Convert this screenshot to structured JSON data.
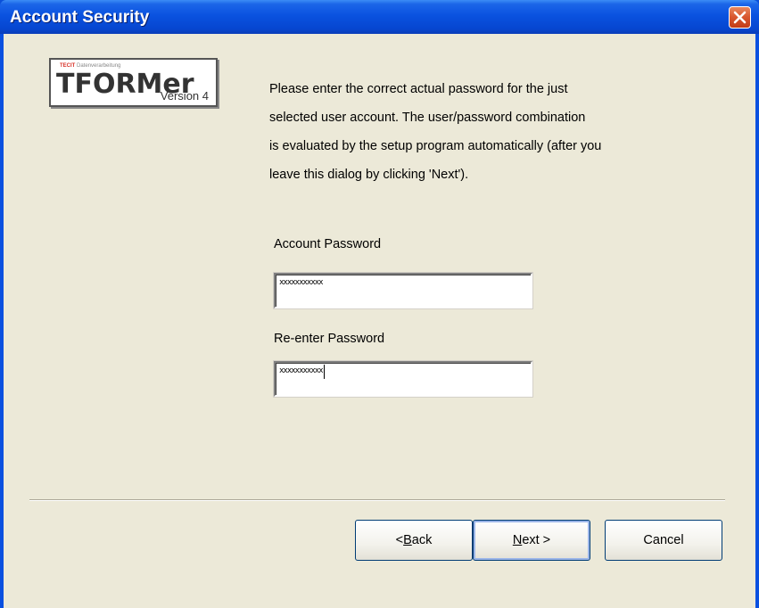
{
  "window": {
    "title": "Account Security"
  },
  "logo": {
    "tagline_prefix": "TECIT",
    "tagline_rest": "Datenverarbeitung",
    "name": "TFORMer",
    "version": "Version 4"
  },
  "description": {
    "lines": [
      "Please enter the correct actual password for the just",
      "selected user account. The user/password combination",
      "is evaluated by the setup program automatically (after you",
      "leave this dialog by clicking 'Next')."
    ]
  },
  "form": {
    "password_label": "Account Password",
    "password_value": "xxxxxxxxxxx",
    "reenter_label": "Re-enter Password",
    "reenter_value": "xxxxxxxxxxx"
  },
  "buttons": {
    "back_prefix": "< ",
    "back_accel": "B",
    "back_rest": "ack",
    "next_accel": "N",
    "next_rest": "ext >",
    "cancel": "Cancel"
  },
  "colors": {
    "titlebar": "#0A52E0",
    "dialog_bg": "#ECE9D8",
    "close_button": "#D8552E"
  },
  "icons": {
    "close": "close-icon"
  }
}
